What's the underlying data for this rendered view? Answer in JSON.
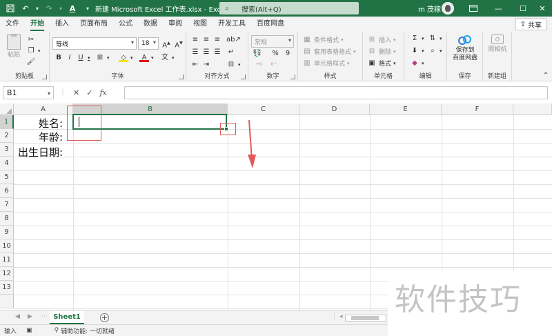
{
  "titlebar": {
    "doc_title": "新建 Microsoft Excel 工作表.xlsx  -  Excel",
    "search_placeholder": "搜索(Alt+Q)",
    "user_name": "m 茂稼",
    "icons": [
      "save-icon",
      "undo-icon",
      "redo-icon",
      "font-color-icon",
      "customize-qat-icon"
    ]
  },
  "ribbon_tabs": [
    "文件",
    "开始",
    "插入",
    "页面布局",
    "公式",
    "数据",
    "审阅",
    "视图",
    "开发工具",
    "百度网盘"
  ],
  "active_tab": "开始",
  "share_label": "共享",
  "ribbon": {
    "clipboard": {
      "label": "剪贴板",
      "paste": "粘贴"
    },
    "font": {
      "label": "字体",
      "font_name": "等线",
      "font_size": "18",
      "bold": "B",
      "italic": "I",
      "underline": "U",
      "font_color_letter": "A"
    },
    "alignment": {
      "label": "对齐方式"
    },
    "number": {
      "label": "数字",
      "format": "常规",
      "percent": "%",
      "comma": "9"
    },
    "styles": {
      "label": "样式",
      "conditional": "条件格式",
      "table": "套用表格格式",
      "cell_styles": "单元格样式"
    },
    "cells": {
      "label": "单元格",
      "insert": "插入",
      "delete": "删除",
      "format": "格式"
    },
    "editing": {
      "label": "编辑"
    },
    "save": {
      "label": "保存",
      "button_line1": "保存到",
      "button_line2": "百度网盘"
    },
    "new_group": {
      "label": "新建组",
      "button": "照相机"
    }
  },
  "formula_bar": {
    "name_box": "B1",
    "formula": ""
  },
  "grid": {
    "columns": [
      "A",
      "B",
      "C",
      "D",
      "E",
      "F"
    ],
    "selected_column": "B",
    "rows": [
      "1",
      "2",
      "3",
      "4",
      "5",
      "6",
      "7",
      "8",
      "9",
      "10",
      "11",
      "12",
      "13"
    ],
    "selected_row": "1",
    "cells": {
      "A1": "姓名:",
      "A2": "年龄:",
      "A3": "出生日期:"
    }
  },
  "sheets": [
    "Sheet1"
  ],
  "active_sheet": "Sheet1",
  "status": {
    "mode": "输入",
    "accessibility": "辅助功能: 一切就绪"
  },
  "watermark": "软件技巧",
  "colors": {
    "accent": "#217346",
    "annotation": "#e05a5a"
  }
}
